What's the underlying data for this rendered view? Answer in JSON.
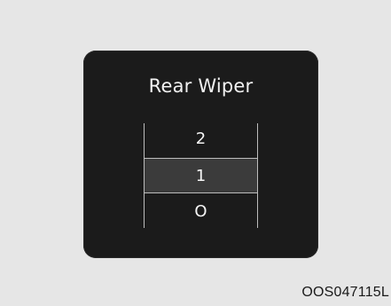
{
  "panel": {
    "title": "Rear Wiper",
    "options": [
      "2",
      "1",
      "O"
    ],
    "selected": "1"
  },
  "figure_code": "OOS047115L"
}
